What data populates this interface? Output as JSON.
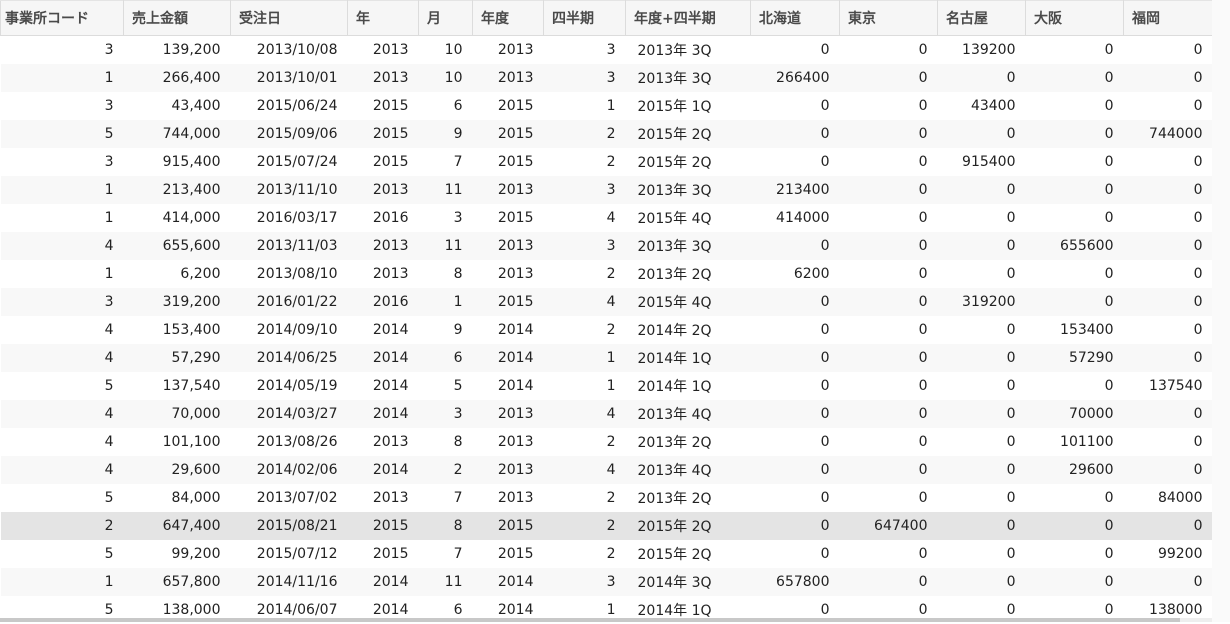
{
  "columns": [
    "事業所コード",
    "売上金額",
    "受注日",
    "年",
    "月",
    "年度",
    "四半期",
    "年度+四半期",
    "北海道",
    "東京",
    "名古屋",
    "大阪",
    "福岡"
  ],
  "rows": [
    [
      "3",
      "139,200",
      "2013/10/08",
      "2013",
      "10",
      "2013",
      "3",
      "2013年 3Q",
      "0",
      "0",
      "139200",
      "0",
      "0"
    ],
    [
      "1",
      "266,400",
      "2013/10/01",
      "2013",
      "10",
      "2013",
      "3",
      "2013年 3Q",
      "266400",
      "0",
      "0",
      "0",
      "0"
    ],
    [
      "3",
      "43,400",
      "2015/06/24",
      "2015",
      "6",
      "2015",
      "1",
      "2015年 1Q",
      "0",
      "0",
      "43400",
      "0",
      "0"
    ],
    [
      "5",
      "744,000",
      "2015/09/06",
      "2015",
      "9",
      "2015",
      "2",
      "2015年 2Q",
      "0",
      "0",
      "0",
      "0",
      "744000"
    ],
    [
      "3",
      "915,400",
      "2015/07/24",
      "2015",
      "7",
      "2015",
      "2",
      "2015年 2Q",
      "0",
      "0",
      "915400",
      "0",
      "0"
    ],
    [
      "1",
      "213,400",
      "2013/11/10",
      "2013",
      "11",
      "2013",
      "3",
      "2013年 3Q",
      "213400",
      "0",
      "0",
      "0",
      "0"
    ],
    [
      "1",
      "414,000",
      "2016/03/17",
      "2016",
      "3",
      "2015",
      "4",
      "2015年 4Q",
      "414000",
      "0",
      "0",
      "0",
      "0"
    ],
    [
      "4",
      "655,600",
      "2013/11/03",
      "2013",
      "11",
      "2013",
      "3",
      "2013年 3Q",
      "0",
      "0",
      "0",
      "655600",
      "0"
    ],
    [
      "1",
      "6,200",
      "2013/08/10",
      "2013",
      "8",
      "2013",
      "2",
      "2013年 2Q",
      "6200",
      "0",
      "0",
      "0",
      "0"
    ],
    [
      "3",
      "319,200",
      "2016/01/22",
      "2016",
      "1",
      "2015",
      "4",
      "2015年 4Q",
      "0",
      "0",
      "319200",
      "0",
      "0"
    ],
    [
      "4",
      "153,400",
      "2014/09/10",
      "2014",
      "9",
      "2014",
      "2",
      "2014年 2Q",
      "0",
      "0",
      "0",
      "153400",
      "0"
    ],
    [
      "4",
      "57,290",
      "2014/06/25",
      "2014",
      "6",
      "2014",
      "1",
      "2014年 1Q",
      "0",
      "0",
      "0",
      "57290",
      "0"
    ],
    [
      "5",
      "137,540",
      "2014/05/19",
      "2014",
      "5",
      "2014",
      "1",
      "2014年 1Q",
      "0",
      "0",
      "0",
      "0",
      "137540"
    ],
    [
      "4",
      "70,000",
      "2014/03/27",
      "2014",
      "3",
      "2013",
      "4",
      "2013年 4Q",
      "0",
      "0",
      "0",
      "70000",
      "0"
    ],
    [
      "4",
      "101,100",
      "2013/08/26",
      "2013",
      "8",
      "2013",
      "2",
      "2013年 2Q",
      "0",
      "0",
      "0",
      "101100",
      "0"
    ],
    [
      "4",
      "29,600",
      "2014/02/06",
      "2014",
      "2",
      "2013",
      "4",
      "2013年 4Q",
      "0",
      "0",
      "0",
      "29600",
      "0"
    ],
    [
      "5",
      "84,000",
      "2013/07/02",
      "2013",
      "7",
      "2013",
      "2",
      "2013年 2Q",
      "0",
      "0",
      "0",
      "0",
      "84000"
    ],
    [
      "2",
      "647,400",
      "2015/08/21",
      "2015",
      "8",
      "2015",
      "2",
      "2015年 2Q",
      "0",
      "647400",
      "0",
      "0",
      "0"
    ],
    [
      "5",
      "99,200",
      "2015/07/12",
      "2015",
      "7",
      "2015",
      "2",
      "2015年 2Q",
      "0",
      "0",
      "0",
      "0",
      "99200"
    ],
    [
      "1",
      "657,800",
      "2014/11/16",
      "2014",
      "11",
      "2014",
      "3",
      "2014年 3Q",
      "657800",
      "0",
      "0",
      "0",
      "0"
    ],
    [
      "5",
      "138,000",
      "2014/06/07",
      "2014",
      "6",
      "2014",
      "1",
      "2014年 1Q",
      "0",
      "0",
      "0",
      "0",
      "138000"
    ]
  ],
  "selected_row_index": 17
}
